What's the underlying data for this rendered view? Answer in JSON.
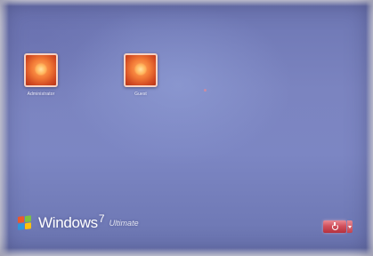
{
  "screen": {
    "title": "Windows 7 logon screen"
  },
  "users": [
    {
      "name": "Administrator",
      "picture_icon": "orange-flower-user-picture"
    },
    {
      "name": "Guest",
      "picture_icon": "orange-flower-user-picture"
    }
  ],
  "branding": {
    "logo_icon": "windows-flag-icon",
    "name": "Windows",
    "version": "7",
    "edition": "Ultimate"
  },
  "shutdown": {
    "icon": "power-icon",
    "options_icon": "chevron-down-icon",
    "color": "#c9444f"
  },
  "colors": {
    "background": "#7b84c0",
    "text": "#ffffff"
  }
}
